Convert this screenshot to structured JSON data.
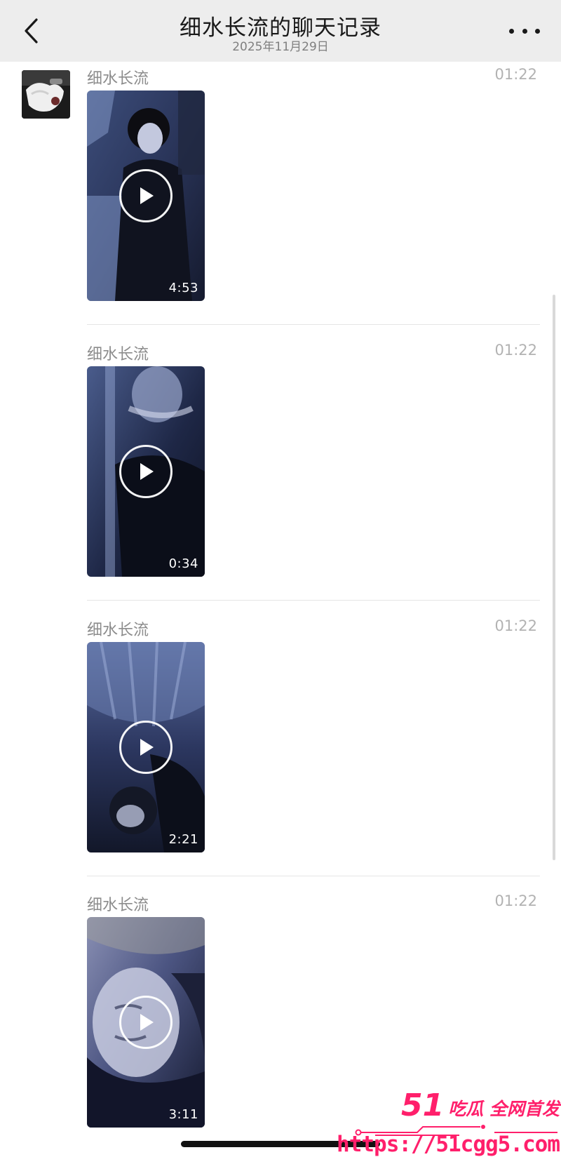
{
  "header": {
    "title": "细水长流的聊天记录",
    "date": "2025年11月29日"
  },
  "messages": [
    {
      "sender": "细水长流",
      "time": "01:22",
      "duration": "4:53"
    },
    {
      "sender": "细水长流",
      "time": "01:22",
      "duration": "0:34"
    },
    {
      "sender": "细水长流",
      "time": "01:22",
      "duration": "2:21"
    },
    {
      "sender": "细水长流",
      "time": "01:22",
      "duration": "3:11"
    }
  ],
  "watermark": {
    "logo": "51",
    "slogan": "吃瓜 全网首发",
    "url": "https://51cgg5.com"
  },
  "colors": {
    "header_bg": "#ededed",
    "watermark": "#ff1f6b"
  }
}
